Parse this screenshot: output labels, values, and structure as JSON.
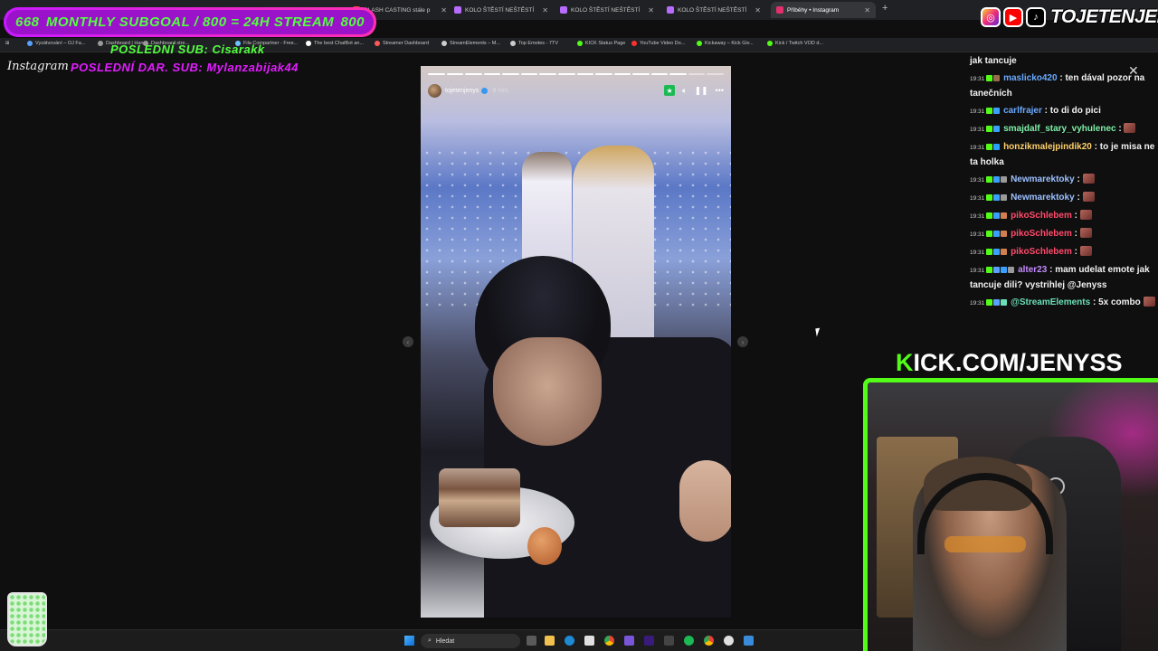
{
  "tabs": [
    {
      "label": "CLASH CASTING stále p",
      "color": "#ff4040",
      "left": 0
    },
    {
      "label": "KOLO ŠTĚSTÍ NEŠTĚSTÍ",
      "color": "#b86bff"
    },
    {
      "label": "KOLO ŠTĚSTÍ NEŠTĚSTÍ",
      "color": "#b86bff"
    },
    {
      "label": "KOLO ŠTĚSTÍ NEŠTĚSTÍ",
      "color": "#b86bff"
    },
    {
      "label": "Příběhy • Instagram",
      "color": "#e1306c",
      "active": true
    }
  ],
  "bookmarks": [
    {
      "label": "Vyzátvování – OJ Fa...",
      "color": "#5aa0ff"
    },
    {
      "label": "Dashboard | Handl...",
      "color": "#9a9a9a"
    },
    {
      "label": "Dashboard stre...",
      "color": "#9a9a9a"
    },
    {
      "label": "Fila Compartner - Free...",
      "color": "#6cc1ff"
    },
    {
      "label": "The best ChatBot an...",
      "color": "#ffffff"
    },
    {
      "label": "Streamer Dashboard",
      "color": "#ff5a5a"
    },
    {
      "label": "StreamElements – M...",
      "color": "#cccccc"
    },
    {
      "label": "Top Emotes - 7TV",
      "color": "#cccccc"
    },
    {
      "label": "KICK Status Page",
      "color": "#53fc18"
    },
    {
      "label": "YouTube Video Do...",
      "color": "#ff3030"
    },
    {
      "label": "Kickaway – Kick Giv...",
      "color": "#53fc18"
    },
    {
      "label": "Kick / Twitch VOD d...",
      "color": "#53fc18"
    }
  ],
  "overlay": {
    "subgoal_left": "668",
    "subgoal_text": "MONTHLY SUBGOAL / 800 = 24H STREAM",
    "subgoal_right": "800",
    "last_sub": "POSLEDNÍ SUB: Cisarakk",
    "last_donation": "POSLEDNÍ DAR. SUB: Mylanzabijak44"
  },
  "instagram": {
    "logo": "Instagram",
    "story_user": "tojetenjenys",
    "story_time": "9 min."
  },
  "socials": {
    "handle": "TOJETENJENYS"
  },
  "kick_url": {
    "k": "K",
    "rest": "ICK.COM/JENYSS"
  },
  "chat": [
    {
      "ts": "",
      "user": "",
      "user_color": "#f2f2f2",
      "text": "jak tancuje",
      "badges": []
    },
    {
      "ts": "19:31",
      "user": "maslicko420",
      "user_color": "#6aa9ff",
      "text": ": ten dával pozor na tanečních",
      "badges": [
        "#53fc18",
        "#9a6b4a"
      ]
    },
    {
      "ts": "19:31",
      "user": "carlfrajer",
      "user_color": "#6aa9ff",
      "text": ": to di do pici",
      "badges": [
        "#53fc18",
        "#3aa0ff"
      ]
    },
    {
      "ts": "19:31",
      "user": "smajdalf_stary_vyhulenec",
      "user_color": "#7ff0a8",
      "text": ":",
      "badges": [
        "#53fc18",
        "#3aa0ff"
      ],
      "emote": true
    },
    {
      "ts": "19:31",
      "user": "honzikmalejpindik20",
      "user_color": "#ffd06b",
      "text": ": to je misa ne ta holka",
      "badges": [
        "#53fc18",
        "#2aa0ff"
      ]
    },
    {
      "ts": "19:31",
      "user": "Newmarektoky",
      "user_color": "#9cc0ff",
      "text": ":",
      "badges": [
        "#53fc18",
        "#3aa0ff",
        "#9a9a9a"
      ],
      "emote": true
    },
    {
      "ts": "19:31",
      "user": "Newmarektoky",
      "user_color": "#9cc0ff",
      "text": ":",
      "badges": [
        "#53fc18",
        "#3aa0ff",
        "#9a9a9a"
      ],
      "emote": true
    },
    {
      "ts": "19:31",
      "user": "pikoSchlebem",
      "user_color": "#ff4b6b",
      "text": ":",
      "badges": [
        "#53fc18",
        "#3aa0ff",
        "#d08050"
      ],
      "emote": true
    },
    {
      "ts": "19:31",
      "user": "pikoSchlebem",
      "user_color": "#ff4b6b",
      "text": ":",
      "badges": [
        "#53fc18",
        "#3aa0ff",
        "#d08050"
      ],
      "emote": true
    },
    {
      "ts": "19:31",
      "user": "pikoSchlebem",
      "user_color": "#ff4b6b",
      "text": ":",
      "badges": [
        "#53fc18",
        "#3aa0ff",
        "#d08050"
      ],
      "emote": true
    },
    {
      "ts": "19:31",
      "user": "alter23",
      "user_color": "#c48bff",
      "text": ": mam udelat emote jak tancuje dili? vystrihlej @Jenyss",
      "badges": [
        "#53fc18",
        "#5aa0ff",
        "#3aa0ff",
        "#9a9a9a"
      ]
    },
    {
      "ts": "19:31",
      "user": "@StreamElements",
      "user_color": "#6be0b8",
      "text": ": 5x combo",
      "badges": [
        "#53fc18",
        "#5aa0ff",
        "#6be0b8"
      ],
      "emote": true
    }
  ],
  "taskbar": {
    "search_placeholder": "Hledat"
  }
}
